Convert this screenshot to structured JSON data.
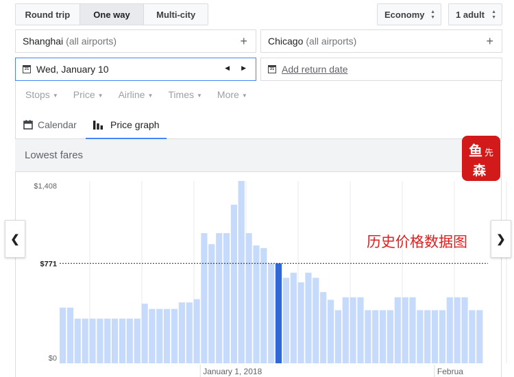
{
  "trip_types": {
    "round_trip": "Round trip",
    "one_way": "One way",
    "multi_city": "Multi-city",
    "active": "One way"
  },
  "cabin": {
    "value": "Economy"
  },
  "passengers": {
    "value": "1 adult"
  },
  "origin": {
    "city": "Shanghai",
    "qualifier": "(all airports)"
  },
  "destination": {
    "city": "Chicago",
    "qualifier": "(all airports)"
  },
  "depart_date": {
    "value": "Wed, January 10",
    "icon_text": "31"
  },
  "return_date": {
    "placeholder": "Add return date",
    "icon_text": "31"
  },
  "filters": [
    "Stops",
    "Price",
    "Airline",
    "Times",
    "More"
  ],
  "view_tabs": {
    "calendar": "Calendar",
    "price_graph": "Price graph",
    "active": "Price graph"
  },
  "section_title": "Lowest fares",
  "stamp": {
    "line1": "鱼",
    "line2": "先",
    "line3": "森"
  },
  "annotation": "历史价格数据图",
  "icons": {
    "prev": "chevron-left-icon",
    "next": "chevron-right-icon"
  },
  "colors": {
    "bar": "#c6dafc",
    "bar_selected": "#3367d6",
    "accent": "#4285f4",
    "stamp": "#d31a1a",
    "annotation": "#e02020"
  },
  "chart_data": {
    "type": "bar",
    "y_tick_labels": [
      "$1,408",
      "$771",
      "$0"
    ],
    "ylim": [
      0,
      1408
    ],
    "reference_line": {
      "value": 771,
      "label": "$771",
      "style": "dashed"
    },
    "x_tick_labels": [
      {
        "label": "January 1, 2018",
        "index": 20
      },
      {
        "label": "Februa",
        "index": 51
      }
    ],
    "selected_index": 29,
    "values": [
      430,
      430,
      345,
      345,
      345,
      345,
      345,
      345,
      345,
      345,
      345,
      460,
      420,
      420,
      420,
      420,
      470,
      470,
      495,
      1005,
      920,
      1005,
      1005,
      1225,
      1408,
      1005,
      910,
      890,
      771,
      771,
      660,
      700,
      625,
      700,
      660,
      550,
      490,
      410,
      510,
      510,
      510,
      410,
      410,
      410,
      410,
      510,
      510,
      510,
      410,
      410,
      410,
      410,
      510,
      510,
      510,
      410,
      410
    ],
    "grid": "vertical"
  }
}
